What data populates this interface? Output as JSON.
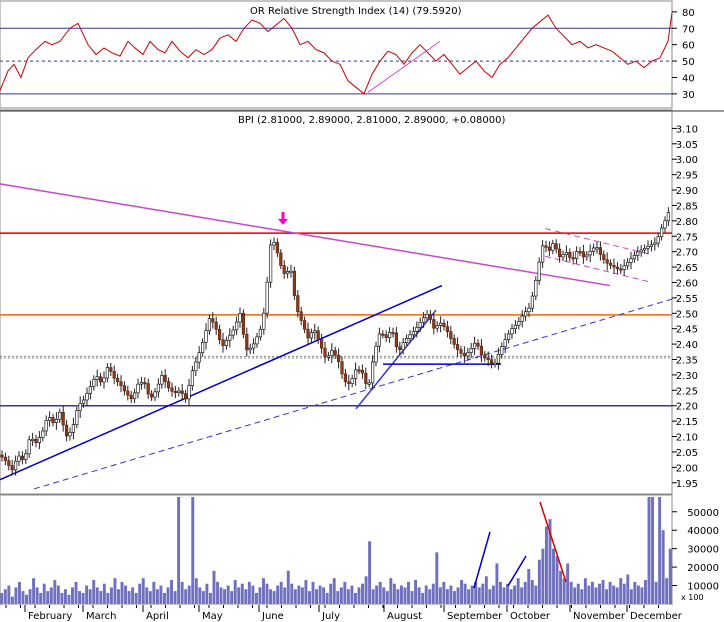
{
  "chart_data": [
    {
      "type": "line",
      "panel": "rsi",
      "title": "OR Relative Strength Index (14) (79.5920)",
      "ylim": [
        22,
        86
      ],
      "yticks": [
        30,
        40,
        50,
        60,
        70,
        80
      ],
      "reference_lines": [
        30,
        50,
        70
      ],
      "series": [
        {
          "color": "#cc0000",
          "x": [
            0,
            8,
            14,
            21,
            28,
            36,
            45,
            52,
            60,
            70,
            78,
            88,
            96,
            104,
            112,
            120,
            128,
            135,
            143,
            150,
            158,
            165,
            172,
            180,
            188,
            196,
            204,
            212,
            220,
            228,
            236,
            244,
            252,
            260,
            268,
            276,
            284,
            292,
            300,
            308,
            316,
            324,
            332,
            340,
            348,
            356,
            364,
            372,
            380,
            388,
            396,
            404,
            412,
            420,
            428,
            436,
            444,
            452,
            460,
            468,
            476,
            484,
            492,
            500,
            508,
            516,
            524,
            532,
            540,
            548,
            556,
            564,
            572,
            580,
            588,
            596,
            604,
            612,
            620,
            628,
            636,
            644,
            652,
            660,
            668,
            672
          ],
          "y": [
            32,
            44,
            48,
            40,
            52,
            57,
            62,
            60,
            62,
            70,
            73,
            60,
            54,
            58,
            55,
            53,
            62,
            58,
            54,
            62,
            57,
            55,
            62,
            56,
            52,
            57,
            54,
            57,
            64,
            66,
            62,
            70,
            75,
            73,
            68,
            72,
            76,
            70,
            60,
            62,
            57,
            55,
            50,
            48,
            38,
            34,
            30,
            42,
            50,
            56,
            54,
            48,
            55,
            60,
            55,
            50,
            54,
            48,
            42,
            46,
            50,
            44,
            40,
            48,
            52,
            58,
            64,
            70,
            74,
            78,
            70,
            65,
            60,
            62,
            58,
            60,
            58,
            56,
            52,
            48,
            50,
            46,
            50,
            52,
            62,
            79.6
          ]
        }
      ],
      "annotations": [
        {
          "type": "trendline",
          "color": "#cc44cc",
          "from": [
            368,
            31
          ],
          "to": [
            440,
            62
          ]
        }
      ]
    },
    {
      "type": "candlestick",
      "panel": "price",
      "title": "BPI (2.81000, 2.89000, 2.81000, 2.89000, +0.08000)",
      "ylim": [
        1.92,
        3.15
      ],
      "yticks": [
        1.95,
        2.0,
        2.05,
        2.1,
        2.15,
        2.2,
        2.25,
        2.3,
        2.35,
        2.4,
        2.45,
        2.5,
        2.55,
        2.6,
        2.65,
        2.7,
        2.75,
        2.8,
        2.85,
        2.9,
        2.95,
        3.0,
        3.05,
        3.1
      ],
      "close_path": {
        "x": [
          0,
          6,
          12,
          18,
          24,
          30,
          36,
          42,
          48,
          54,
          60,
          66,
          72,
          78,
          84,
          90,
          96,
          102,
          108,
          114,
          120,
          126,
          132,
          138,
          144,
          150,
          156,
          162,
          168,
          174,
          180,
          186,
          192,
          198,
          204,
          210,
          216,
          222,
          228,
          234,
          240,
          246,
          252,
          258,
          262,
          266,
          270,
          274,
          278,
          282,
          286,
          290,
          296,
          302,
          308,
          314,
          320,
          326,
          332,
          338,
          344,
          350,
          356,
          362,
          368,
          374,
          380,
          386,
          392,
          398,
          404,
          410,
          416,
          422,
          428,
          434,
          440,
          446,
          452,
          458,
          464,
          470,
          476,
          482,
          488,
          494,
          500,
          506,
          512,
          518,
          524,
          530,
          536,
          540,
          544,
          548,
          552,
          556,
          560,
          566,
          572,
          578,
          584,
          590,
          596,
          602,
          608,
          614,
          620,
          626,
          632,
          638,
          644,
          650,
          656,
          662,
          668,
          672
        ],
        "close": [
          2.04,
          2.02,
          1.99,
          2.04,
          2.02,
          2.1,
          2.08,
          2.11,
          2.17,
          2.14,
          2.18,
          2.1,
          2.12,
          2.2,
          2.22,
          2.26,
          2.3,
          2.27,
          2.33,
          2.29,
          2.27,
          2.24,
          2.22,
          2.27,
          2.28,
          2.22,
          2.25,
          2.3,
          2.26,
          2.24,
          2.25,
          2.22,
          2.31,
          2.36,
          2.42,
          2.49,
          2.45,
          2.39,
          2.42,
          2.45,
          2.5,
          2.38,
          2.39,
          2.43,
          2.46,
          2.55,
          2.72,
          2.73,
          2.69,
          2.64,
          2.62,
          2.66,
          2.52,
          2.47,
          2.42,
          2.45,
          2.4,
          2.35,
          2.38,
          2.35,
          2.28,
          2.27,
          2.32,
          2.31,
          2.25,
          2.37,
          2.44,
          2.42,
          2.45,
          2.37,
          2.41,
          2.43,
          2.45,
          2.48,
          2.5,
          2.45,
          2.47,
          2.45,
          2.41,
          2.38,
          2.36,
          2.38,
          2.41,
          2.36,
          2.35,
          2.33,
          2.38,
          2.42,
          2.45,
          2.47,
          2.5,
          2.52,
          2.61,
          2.68,
          2.74,
          2.69,
          2.73,
          2.71,
          2.68,
          2.7,
          2.67,
          2.71,
          2.68,
          2.7,
          2.72,
          2.68,
          2.66,
          2.65,
          2.64,
          2.66,
          2.68,
          2.7,
          2.71,
          2.72,
          2.73,
          2.78,
          2.82,
          2.89
        ]
      },
      "horizontal_lines": [
        {
          "y": 2.76,
          "color": "#dd0000"
        },
        {
          "y": 2.495,
          "color": "#ee6600"
        },
        {
          "y": 2.2,
          "color": "#3333aa"
        },
        {
          "y": 2.36,
          "color": "#888888",
          "style": "dotted"
        },
        {
          "y": 2.355,
          "color": "#888888",
          "style": "dotted"
        }
      ],
      "trendlines": [
        {
          "color": "#cc44cc",
          "from": [
            0,
            2.92
          ],
          "to": [
            610,
            2.59
          ]
        },
        {
          "color": "#0000cc",
          "from": [
            0,
            1.96
          ],
          "to": [
            442,
            2.59
          ]
        },
        {
          "color": "#3333cc",
          "style": "dashed",
          "from": [
            34,
            1.93
          ],
          "to": [
            676,
            2.55
          ]
        },
        {
          "color": "#3333cc",
          "from": [
            356,
            2.19
          ],
          "to": [
            436,
            2.51
          ]
        },
        {
          "color": "#0000cc",
          "from": [
            383,
            2.335
          ],
          "to": [
            501,
            2.335
          ]
        },
        {
          "color": "#cc44cc",
          "style": "dashed",
          "from": [
            545,
            2.775
          ],
          "to": [
            652,
            2.69
          ]
        },
        {
          "color": "#cc44cc",
          "style": "dashed",
          "from": [
            545,
            2.685
          ],
          "to": [
            652,
            2.6
          ]
        }
      ],
      "markers": [
        {
          "type": "down-arrow",
          "color": "#ff00cc",
          "x": 283,
          "y": 2.79
        }
      ]
    },
    {
      "type": "bar",
      "panel": "volume",
      "ylim": [
        0,
        58000
      ],
      "yticks": [
        10000,
        20000,
        30000,
        40000,
        50000
      ],
      "unit_label": "x 100",
      "bar_color": "#7070c0",
      "values": [
        6,
        8,
        10,
        4,
        9,
        12,
        7,
        5,
        8,
        14,
        9,
        6,
        11,
        7,
        9,
        13,
        10,
        6,
        8,
        5,
        9,
        12,
        7,
        6,
        10,
        8,
        13,
        9,
        7,
        11,
        6,
        9,
        14,
        8,
        12,
        10,
        7,
        9,
        6,
        11,
        14,
        9,
        7,
        12,
        8,
        10,
        6,
        9,
        13,
        7,
        58,
        12,
        8,
        10,
        58,
        14,
        9,
        7,
        11,
        6,
        18,
        12,
        9,
        8,
        10,
        7,
        13,
        9,
        11,
        8,
        12,
        10,
        6,
        9,
        14,
        11,
        8,
        7,
        10,
        12,
        9,
        18,
        11,
        8,
        10,
        9,
        13,
        7,
        12,
        8,
        10,
        9,
        6,
        11,
        14,
        7,
        9,
        12,
        8,
        10,
        6,
        9,
        11,
        15,
        34,
        8,
        10,
        12,
        9,
        7,
        14,
        11,
        8,
        10,
        9,
        12,
        7,
        13,
        9,
        6,
        10,
        8,
        11,
        28,
        9,
        12,
        8,
        10,
        7,
        9,
        13,
        11,
        8,
        10,
        12,
        9,
        11,
        15,
        8,
        10,
        22,
        12,
        9,
        11,
        8,
        10,
        14,
        9,
        12,
        19,
        13,
        10,
        24,
        30,
        42,
        46,
        30,
        26,
        18,
        14,
        22,
        12,
        9,
        11,
        8,
        14,
        10,
        12,
        9,
        11,
        13,
        8,
        12,
        10,
        9,
        14,
        11,
        16,
        8,
        12,
        10,
        9,
        13,
        58,
        58,
        12,
        58,
        40,
        14,
        30
      ]
    }
  ],
  "xaxis": {
    "months": [
      "February",
      "March",
      "April",
      "May",
      "June",
      "July",
      "August",
      "September",
      "October",
      "November",
      "December"
    ]
  }
}
